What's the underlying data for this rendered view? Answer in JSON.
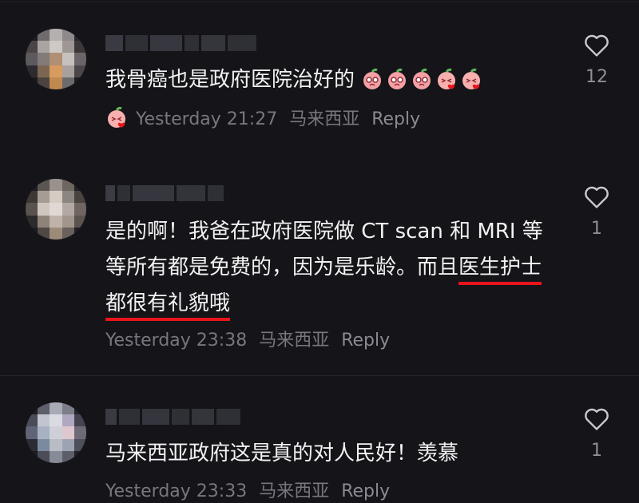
{
  "comments": [
    {
      "text": "我骨癌也是政府医院治好的",
      "time": "Yesterday 21:27",
      "location": "马来西亚",
      "reply_label": "Reply",
      "like_count": "12",
      "emojis": [
        "crying-face",
        "crying-face",
        "crying-face",
        "kiss-face",
        "kiss-face",
        "kiss-face"
      ]
    },
    {
      "text_before": "是的啊！我爸在政府医院做 CT scan 和 MRI 等等所有都是免费的，因为是乐龄。而且",
      "text_underlined": "医生护士都很有礼貌哦",
      "time": "Yesterday 23:38",
      "location": "马来西亚",
      "reply_label": "Reply",
      "like_count": "1"
    },
    {
      "text": "马来西亚政府这是真的对人民好！羡慕",
      "time": "Yesterday 23:33",
      "location": "马来西亚",
      "reply_label": "Reply",
      "like_count": "1"
    }
  ],
  "colors": {
    "background": "#141419",
    "text": "#f2f2f2",
    "meta": "#77777f",
    "underline": "#e8141b",
    "heart": "#c9c9cf"
  },
  "icons": {
    "like": "heart-outline-icon",
    "emoji": "peach-face-emoji"
  }
}
